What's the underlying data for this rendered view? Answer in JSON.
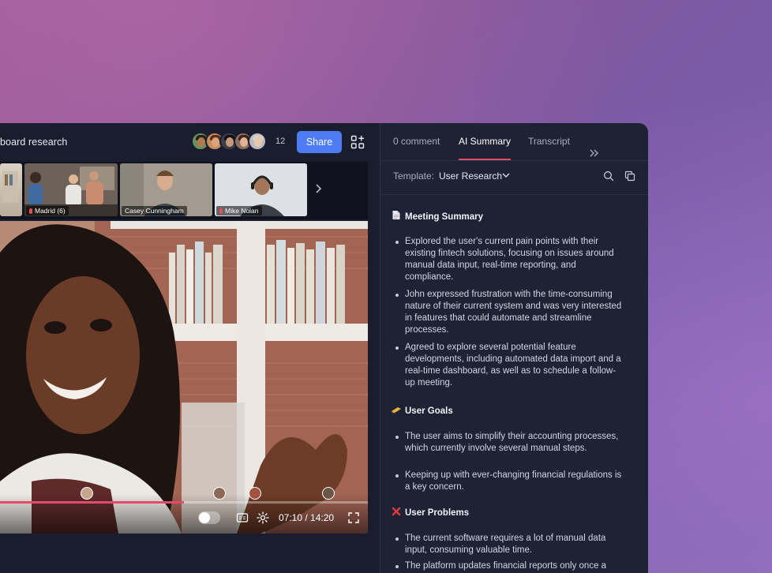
{
  "header": {
    "title": "board research",
    "participant_count": "12",
    "share_label": "Share",
    "apps_icon": "grid-plus-icon"
  },
  "thumbnails": [
    {
      "label": "",
      "muted": false
    },
    {
      "label": "Madrid (6)",
      "muted": true
    },
    {
      "label": "Casey Cunningham",
      "muted": false
    },
    {
      "label": "Mike Nolan",
      "muted": true
    }
  ],
  "player": {
    "time": "07:10 / 14:20",
    "progress": 0.5
  },
  "panel": {
    "tabs": [
      {
        "label": "0 comment"
      },
      {
        "label": "AI Summary"
      },
      {
        "label": "Transcript"
      }
    ],
    "active_tab": "AI Summary",
    "template_label": "Template:",
    "template_value": "User Research",
    "sections": [
      {
        "icon": "document-icon",
        "title": "Meeting Summary",
        "bullets": [
          "Explored the user's current pain points with their existing fintech solutions, focusing on issues around manual data input, real-time reporting, and compliance.",
          "John expressed frustration with the time-consuming nature of their current system and was very interested in features that could automate and streamline processes.",
          "Agreed to explore several potential feature developments, including automated data import and a real-time dashboard, as well as to schedule a follow-up meeting."
        ]
      },
      {
        "icon": "goal-icon",
        "title": "User Goals",
        "bullets": [
          "The user aims to simplify their accounting processes, which currently involve several manual steps.",
          "Keeping up with ever-changing financial regulations is a key concern."
        ]
      },
      {
        "icon": "cross-icon",
        "title": "User Problems",
        "bullets": [
          "The current software requires a lot of manual data input, consuming valuable time.",
          "The platform updates financial reports only once a"
        ]
      }
    ]
  },
  "colors": {
    "accent": "#4d7cf5",
    "tab_underline": "#e24b6a",
    "panel_bg": "#1e2235"
  }
}
